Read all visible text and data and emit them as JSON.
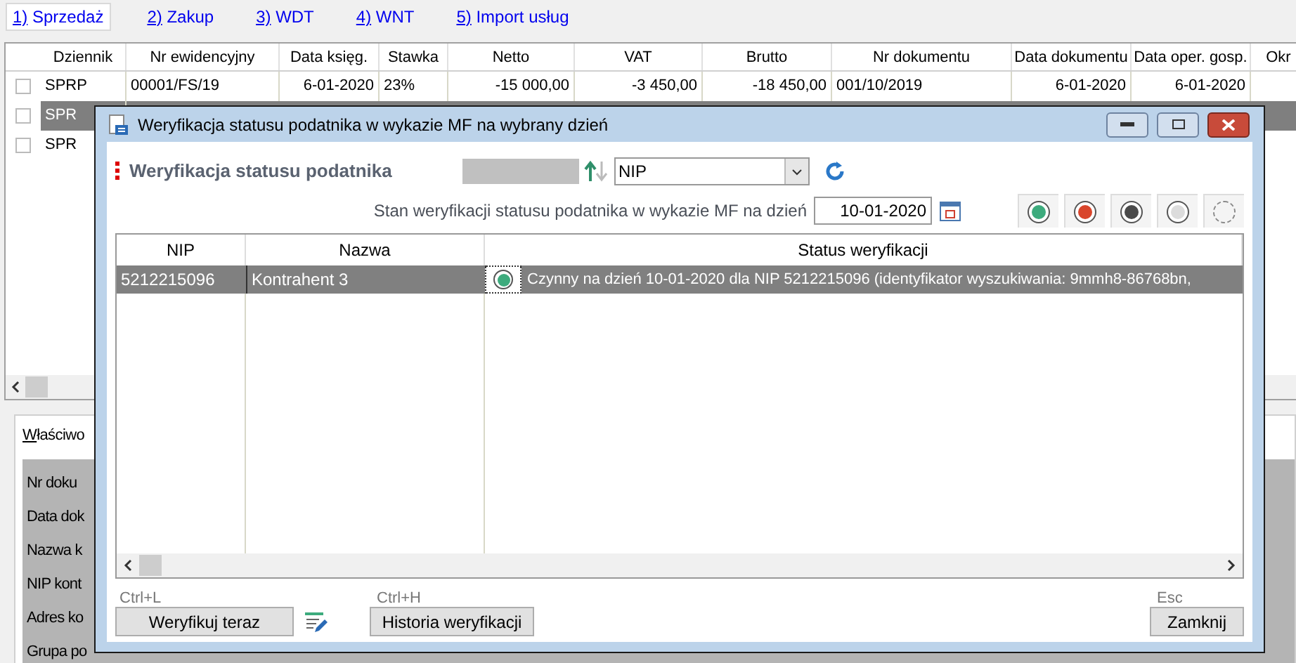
{
  "tabs": [
    {
      "label": "1) Sprzedaż",
      "selected": true
    },
    {
      "label": "2) Zakup",
      "selected": false
    },
    {
      "label": "3) WDT",
      "selected": false
    },
    {
      "label": "4) WNT",
      "selected": false
    },
    {
      "label": "5) Import usług",
      "selected": false
    }
  ],
  "table": {
    "columns": [
      "Dziennik",
      "Nr ewidencyjny",
      "Data księg.",
      "Stawka",
      "Netto",
      "VAT",
      "Brutto",
      "Nr dokumentu",
      "Data dokumentu",
      "Data oper. gosp.",
      "Okr"
    ],
    "rows": [
      {
        "selected": false,
        "checked": false,
        "cells": [
          "SPRP",
          "00001/FS/19",
          "6-01-2020",
          "23%",
          "-15 000,00",
          "-3 450,00",
          "-18 450,00",
          "001/10/2019",
          "6-01-2020",
          "6-01-2020"
        ]
      },
      {
        "selected": true,
        "checked": false,
        "cells": [
          "SPR"
        ]
      },
      {
        "selected": false,
        "checked": false,
        "cells": [
          "SPR"
        ]
      }
    ]
  },
  "properties": {
    "title": "Właściwo",
    "labels": [
      "Nr doku",
      "Data dok",
      "Nazwa k",
      "NIP kont",
      "Adres ko",
      "Grupa po"
    ]
  },
  "dialog": {
    "title": "Weryfikacja statusu podatnika w wykazie MF na wybrany dzień",
    "heading": "Weryfikacja statusu podatnika",
    "search_by": {
      "value": "NIP"
    },
    "date_label": "Stan weryfikacji statusu podatnika w wykazie MF na dzień",
    "date_value": "10-01-2020",
    "status_filters": [
      {
        "kind": "solid",
        "color": "#3dab7d"
      },
      {
        "kind": "solid",
        "color": "#d9452b"
      },
      {
        "kind": "solid",
        "color": "#4a4a4a"
      },
      {
        "kind": "solid",
        "color": "#dcdcdc"
      },
      {
        "kind": "dashed"
      }
    ],
    "grid": {
      "columns": [
        "NIP",
        "Nazwa",
        "Status weryfikacji"
      ],
      "rows": [
        {
          "selected": true,
          "color": "#3dab7d",
          "cells": [
            "5212215096",
            "Kontrahent 3",
            "Czynny na dzień 10-01-2020 dla NIP 5212215096 (identyfikator wyszukiwania: 9mmh8-86768bn,"
          ]
        }
      ]
    },
    "buttons": [
      {
        "shortcut": "Ctrl+L",
        "label": "Weryfikuj teraz"
      },
      {
        "shortcut": "Ctrl+H",
        "label": "Historia weryfikacji"
      },
      {
        "shortcut": "Esc",
        "label": "Zamknij"
      }
    ]
  }
}
